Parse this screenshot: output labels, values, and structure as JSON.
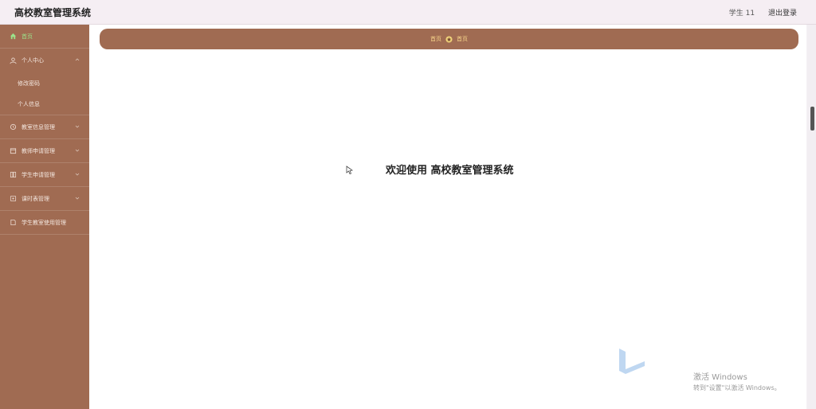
{
  "app": {
    "title": "高校教室管理系统"
  },
  "header": {
    "user_label": "学生 11",
    "logout_label": "退出登录"
  },
  "sidebar": {
    "items": [
      {
        "label": "首页",
        "icon": "home-icon",
        "active": true
      },
      {
        "label": "个人中心",
        "icon": "user-icon"
      },
      {
        "label": "修改密码",
        "sub": true
      },
      {
        "label": "个人信息",
        "sub": true
      },
      {
        "label": "教室信息管理",
        "icon": "clock-icon"
      },
      {
        "label": "教师申请管理",
        "icon": "calendar-icon"
      },
      {
        "label": "学生申请管理",
        "icon": "grid-icon"
      },
      {
        "label": "课时表管理",
        "icon": "table-icon"
      },
      {
        "label": "学生教室使用管理",
        "icon": "doc-icon"
      }
    ]
  },
  "breadcrumb": {
    "home": "首页",
    "current": "首页"
  },
  "main": {
    "welcome": "欢迎使用 高校教室管理系统"
  },
  "watermark": {
    "line1": "激活 Windows",
    "line2": "转到\"设置\"以激活 Windows。"
  },
  "colors": {
    "sidebar_bg": "#a06b52",
    "active_text": "#9be38a",
    "breadcrumb_text": "#f7d58a"
  }
}
